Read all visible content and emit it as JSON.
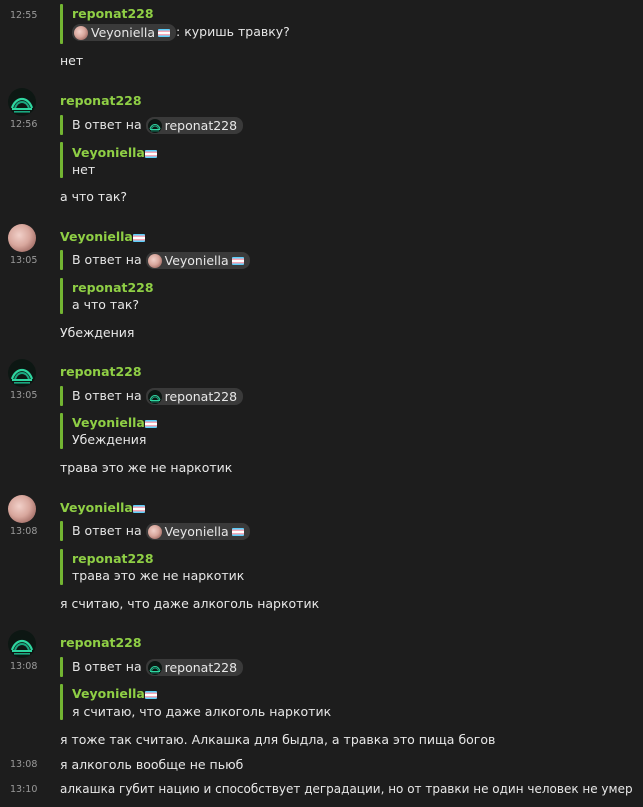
{
  "messages": {
    "m1": {
      "time": "12:55",
      "quote_author": "reponat228",
      "mention": "Veyoniella",
      "quote_text": ": куришь травку?",
      "text": "нет"
    },
    "m2": {
      "author": "reponat228",
      "time": "12:56",
      "reply_prefix": "В ответ на",
      "reply_to": "reponat228",
      "quote_author": "Veyoniella",
      "quote_text": "нет",
      "text": "а что так?"
    },
    "m3": {
      "author": "Veyoniella",
      "time": "13:05",
      "reply_prefix": "В ответ на",
      "reply_to": "Veyoniella",
      "quote_author": "reponat228",
      "quote_text": "а что так?",
      "text": "Убеждения"
    },
    "m4": {
      "author": "reponat228",
      "time": "13:05",
      "reply_prefix": "В ответ на",
      "reply_to": "reponat228",
      "quote_author": "Veyoniella",
      "quote_text": "Убеждения",
      "text": "трава это же не наркотик"
    },
    "m5": {
      "author": "Veyoniella",
      "time": "13:08",
      "reply_prefix": "В ответ на",
      "reply_to": "Veyoniella",
      "quote_author": "reponat228",
      "quote_text": "трава это же не наркотик",
      "text": "я считаю, что даже алкоголь наркотик"
    },
    "m6": {
      "author": "reponat228",
      "time": "13:08",
      "reply_prefix": "В ответ на",
      "reply_to": "reponat228",
      "quote_author": "Veyoniella",
      "quote_text": "я считаю, что даже алкоголь наркотик",
      "text": "я тоже так считаю. Алкашка для быдла, а травка это пища богов"
    },
    "m7": {
      "time": "13:08",
      "text": "я алкоголь вообще не пьюб"
    },
    "m8": {
      "time": "13:10",
      "text": "алкашка губит нацию и способствует деградации, но от травки не один человек не умер"
    }
  },
  "colors": {
    "background": "#1d1d1d",
    "accent": "#8fcf45",
    "quote_bar": "#73b532",
    "chip": "#3a3a3a"
  },
  "icons": {
    "avatar_reponat": "reponat-avatar-icon",
    "avatar_veyoniella": "veyoniella-avatar-icon",
    "flag": "trans-flag-icon"
  }
}
